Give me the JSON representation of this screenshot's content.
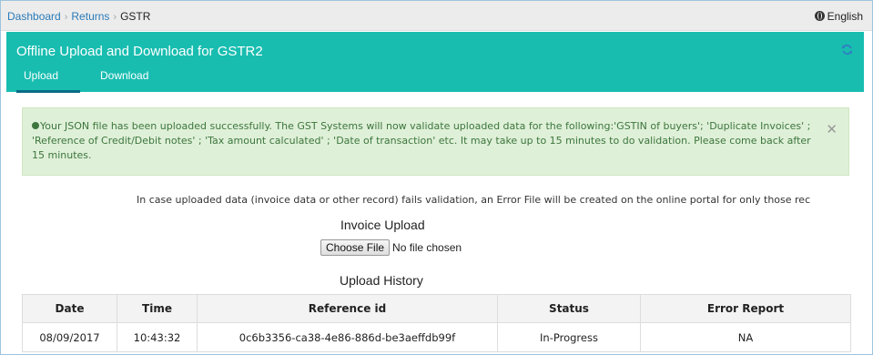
{
  "breadcrumb": {
    "items": [
      "Dashboard",
      "Returns"
    ],
    "current": "GSTR"
  },
  "language": {
    "label": "English"
  },
  "header": {
    "title": "Offline Upload and Download for GSTR2",
    "tabs": [
      {
        "label": "Upload",
        "active": true
      },
      {
        "label": "Download",
        "active": false
      }
    ]
  },
  "alert": {
    "message": "Your JSON file has been uploaded successfully. The GST Systems will now validate uploaded data for the following:'GSTIN of buyers'; 'Duplicate Invoices' ; 'Reference of Credit/Debit notes' ; 'Tax amount calculated' ; 'Date of transaction' etc. It may take up to 15 minutes to do validation. Please come back after 15 minutes.",
    "close_glyph": "✕"
  },
  "info_text": "In case uploaded data (invoice data or other record) fails validation, an Error File will be created on the online portal for only those rec",
  "invoice_upload": {
    "title": "Invoice Upload",
    "button_label": "Choose File",
    "file_status": "No file chosen"
  },
  "upload_history": {
    "title": "Upload History",
    "columns": [
      "Date",
      "Time",
      "Reference id",
      "Status",
      "Error Report"
    ],
    "rows": [
      [
        "08/09/2017",
        "10:43:32",
        "0c6b3356-ca38-4e86-886d-be3aeffdb99f",
        "In-Progress",
        "NA"
      ]
    ]
  },
  "colors": {
    "header_bg": "#18bdb0",
    "tab_underline": "#0b6d86",
    "alert_bg": "#dff0d8",
    "alert_text": "#3c763d",
    "link": "#2a7bb8"
  },
  "icons": [
    "chevron-right-icon",
    "globe-icon",
    "refresh-icon",
    "check-circle-icon",
    "close-icon"
  ]
}
